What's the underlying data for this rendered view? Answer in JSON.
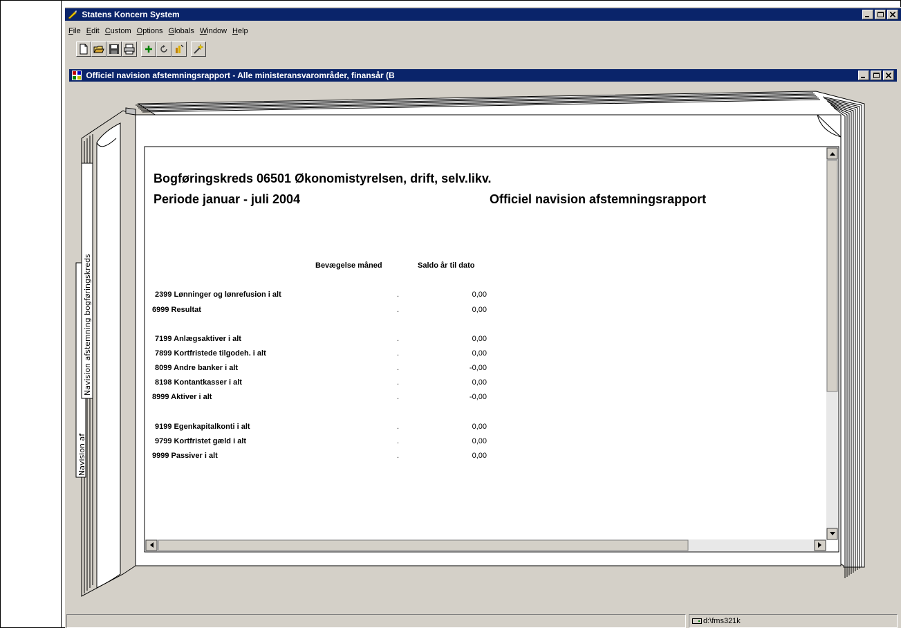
{
  "app": {
    "title": "Statens Koncern System",
    "menu": [
      "File",
      "Edit",
      "Custom",
      "Options",
      "Globals",
      "Window",
      "Help"
    ]
  },
  "toolbar_icons": [
    "new-document-icon",
    "open-folder-icon",
    "save-disk-icon",
    "print-icon",
    "add-plus-icon",
    "refresh-icon",
    "run-report-icon",
    "wizard-wand-icon"
  ],
  "document": {
    "title": "Officiel navision afstemningsrapport - Alle ministeransvarområder, finansår  (B",
    "tabs": [
      "Navision afstemning bogføringskreds",
      "Navision af"
    ]
  },
  "report": {
    "heading": "Bogføringskreds 06501 Økonomistyrelsen, drift, selv.likv.",
    "period": "Periode januar - juli 2004",
    "report_title": "Officiel navision afstemningsrapport",
    "col_month": "Bevægelse måned",
    "col_ytd": "Saldo år til dato",
    "rows": [
      {
        "label": "2399 Lønninger og lønrefusion i alt",
        "month": ".",
        "ytd": "0,00"
      },
      {
        "label": "6999 Resultat",
        "month": ".",
        "ytd": "0,00"
      },
      {
        "label": "7199 Anlægsaktiver i alt",
        "month": ".",
        "ytd": "0,00"
      },
      {
        "label": "7899 Kortfristede tilgodeh. i alt",
        "month": ".",
        "ytd": "0,00"
      },
      {
        "label": "8099 Andre banker i alt",
        "month": ".",
        "ytd": "-0,00"
      },
      {
        "label": "8198 Kontantkasser i alt",
        "month": ".",
        "ytd": "0,00"
      },
      {
        "label": "8999 Aktiver i alt",
        "month": ".",
        "ytd": "-0,00"
      },
      {
        "label": "9199 Egenkapitalkonti i alt",
        "month": ".",
        "ytd": "0,00"
      },
      {
        "label": "9799 Kortfristet gæld i alt",
        "month": ".",
        "ytd": "0,00"
      },
      {
        "label": "9999 Passiver i alt",
        "month": ".",
        "ytd": "0,00"
      }
    ]
  },
  "status": {
    "path": "d:\\fms321k"
  }
}
